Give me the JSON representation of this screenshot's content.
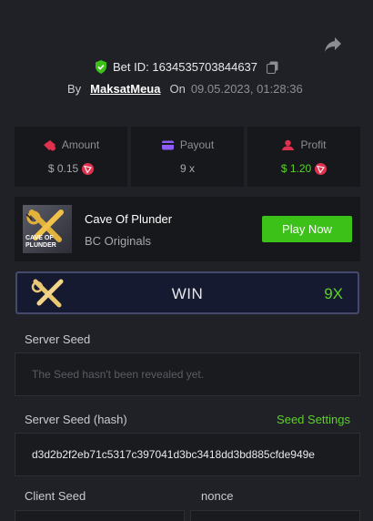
{
  "header": {
    "bet_id_label": "Bet ID: 1634535703844637",
    "by_label": "By",
    "username": "MaksatMeua",
    "on_label": "On",
    "datetime": "09.05.2023, 01:28:36"
  },
  "stats": {
    "amount": {
      "label": "Amount",
      "value": "$ 0.15"
    },
    "payout": {
      "label": "Payout",
      "value": "9 x"
    },
    "profit": {
      "label": "Profit",
      "value": "$ 1.20"
    }
  },
  "game": {
    "title": "Cave Of Plunder",
    "provider": "BC Originals",
    "thumb_text": "CAVE OF PLUNDER",
    "play_label": "Play Now"
  },
  "result": {
    "label": "WIN",
    "multiplier": "9X"
  },
  "seeds": {
    "server_seed_label": "Server Seed",
    "server_seed_placeholder": "The Seed hasn't been revealed yet.",
    "server_seed_hash_label": "Server Seed (hash)",
    "seed_settings_label": "Seed Settings",
    "server_seed_hash": "d3d2b2f2eb71c5317c397041d3bc3418dd3bd885cfde949e",
    "client_seed_label": "Client Seed",
    "nonce_label": "nonce"
  },
  "colors": {
    "accent_green": "#5cd12a",
    "button_green": "#3bc117",
    "background": "#1f2126",
    "panel": "#17181b",
    "win_border": "#454a6c"
  }
}
